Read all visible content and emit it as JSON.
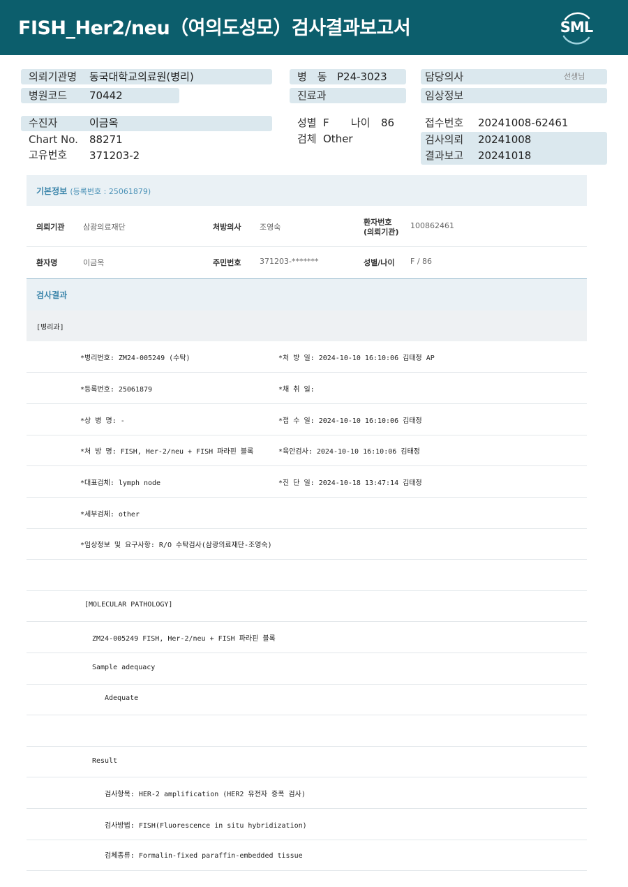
{
  "header": {
    "title": "FISH_Her2/neu（여의도성모）검사결과보고서",
    "logo_text": "SML",
    "colors": {
      "header_bg": "#0c5e6c",
      "pill_bg": "#dbe8ee",
      "section_blue": "#3c86ab"
    }
  },
  "top_info": {
    "request_institution": {
      "label": "의뢰기관명",
      "value": "동국대학교의료원(병리)"
    },
    "hospital_code": {
      "label": "병원코드",
      "value": "70442"
    },
    "ward": {
      "label": "병　동",
      "value": "P24-3023"
    },
    "department": {
      "label": "진료과",
      "value": ""
    },
    "attending_doctor": {
      "label": "담당의사",
      "suffix": "선생님"
    },
    "clinical_info": {
      "label": "임상정보",
      "value": ""
    },
    "patient": {
      "label": "수진자",
      "value": "이금옥"
    },
    "chart_no": {
      "label": "Chart No.",
      "value": "88271"
    },
    "unique_no": {
      "label": "고유번호",
      "value": "371203-2"
    },
    "sex": {
      "label": "성별",
      "value": "F"
    },
    "age": {
      "label": "나이",
      "value": "86"
    },
    "specimen": {
      "label": "검체",
      "value": "Other"
    },
    "receipt_no": {
      "label": "접수번호",
      "value": "20241008-62461"
    },
    "request_date": {
      "label": "검사의뢰",
      "value": "20241008"
    },
    "report_date": {
      "label": "결과보고",
      "value": "20241018"
    }
  },
  "basic_info": {
    "section_title": "기본정보",
    "section_sub": "(등록번호 : 25061879)",
    "row1": [
      {
        "label": "의뢰기관",
        "value": "삼광의료재단"
      },
      {
        "label": "처방의사",
        "value": "조영숙"
      },
      {
        "label_line1": "환자번호",
        "label_line2": "(의뢰기관)",
        "value": "100862461"
      }
    ],
    "row2": [
      {
        "label": "환자명",
        "value": "이금옥"
      },
      {
        "label": "주민번호",
        "value": "371203-*******"
      },
      {
        "label": "성별/나이",
        "value": "F / 86"
      }
    ]
  },
  "results": {
    "section_title": "검사결과",
    "pathology_tag": "[병리과]",
    "lines": [
      {
        "left": "*병리번호: ZM24-005249 (수탁)",
        "right": "*처 방 일: 2024-10-10 16:10:06  김태정 AP"
      },
      {
        "left": "*등록번호: 25061879",
        "right": "*채 취 일:"
      },
      {
        "left": "*상 병 명: -",
        "right": "*접 수 일: 2024-10-10 16:10:06  김태정"
      },
      {
        "left": "*처 방 명: FISH, Her-2/neu + FISH 파라핀 블록",
        "right": "*육안검사: 2024-10-10 16:10:06  김태정"
      },
      {
        "left": "*대표검체: lymph node",
        "right": "*진 단 일: 2024-10-18 13:47:14  김태정"
      },
      {
        "left": "*세부검체: other",
        "right": ""
      },
      {
        "left": "*임상정보 및 요구사항: R/O 수탁검사(삼광의료재단-조영숙)",
        "right": ""
      }
    ],
    "molecular": [
      "[MOLECULAR PATHOLOGY]",
      "ZM24-005249     FISH, Her-2/neu + FISH 파라핀 블록",
      "Sample adequacy",
      "Adequate",
      "",
      "Result",
      "검사항목: HER-2 amplification (HER2 유전자 증폭 검사)",
      "검사방법: FISH(Fluorescence in situ hybridization)",
      "검체종류: Formalin-fixed paraffin-embedded tissue"
    ]
  }
}
